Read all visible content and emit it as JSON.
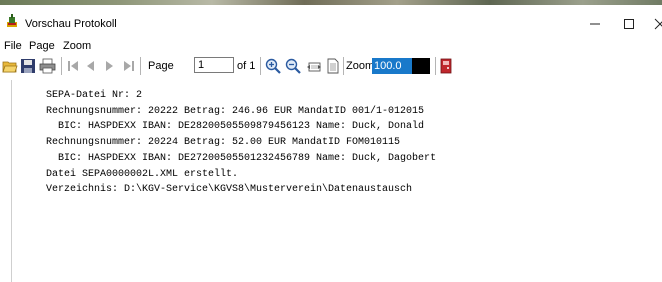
{
  "window": {
    "title": "Vorschau Protokoll",
    "controls": {
      "minimize": "—",
      "maximize": "☐",
      "close": "✕"
    }
  },
  "menu": {
    "items": [
      "File",
      "Page",
      "Zoom"
    ]
  },
  "toolbar": {
    "page_label": "Page",
    "page_value": "1",
    "of_label": "of 1",
    "zoom_label": "Zoom",
    "zoom_value": "100.0"
  },
  "log": {
    "lines": [
      "SEPA-Datei Nr: 2",
      "Rechnungsnummer: 20222 Betrag: 246.96 EUR MandatID 001/1-012015",
      "  BIC: HASPDEXX IBAN: DE28200505509879456123 Name: Duck, Donald",
      "Rechnungsnummer: 20224 Betrag: 52.00 EUR MandatID FOM010115",
      "  BIC: HASPDEXX IBAN: DE27200505501232456789 Name: Duck, Dagobert",
      "Datei SEPA0000002L.XML erstellt.",
      "Verzeichnis: D:\\KGV-Service\\KGVS8\\Musterverein\\Datenaustausch"
    ]
  },
  "colors": {
    "zoom_highlight": "#1979ca",
    "exit_icon": "#c0282d"
  },
  "icons": [
    "app-icon",
    "open-folder-icon",
    "save-icon",
    "print-icon",
    "first-page-icon",
    "previous-page-icon",
    "next-page-icon",
    "last-page-icon",
    "zoom-in-icon",
    "zoom-out-icon",
    "fit-width-icon",
    "fit-page-icon",
    "exit-icon"
  ]
}
